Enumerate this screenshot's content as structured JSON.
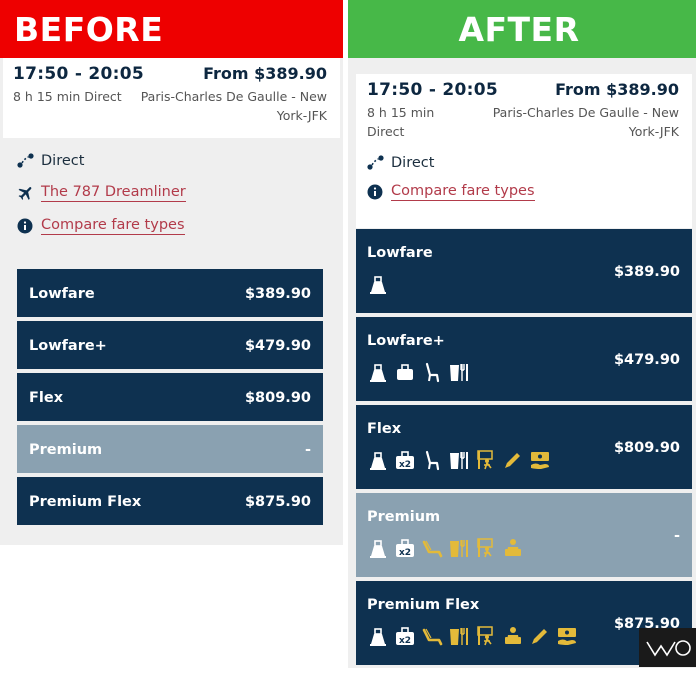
{
  "before": {
    "banner": "BEFORE",
    "flight": {
      "times": "17:50 - 20:05",
      "price": "From $389.90",
      "duration": "8 h 15 min Direct",
      "route": "Paris-Charles De Gaulle - New York-JFK"
    },
    "info": {
      "direct": "Direct",
      "aircraft": "The 787 Dreamliner",
      "compare": "Compare fare types"
    },
    "fares": [
      {
        "name": "Lowfare",
        "price": "$389.90"
      },
      {
        "name": "Lowfare+",
        "price": "$479.90"
      },
      {
        "name": "Flex",
        "price": "$809.90"
      },
      {
        "name": "Premium",
        "price": "-"
      },
      {
        "name": "Premium Flex",
        "price": "$875.90"
      }
    ]
  },
  "after": {
    "banner": "AFTER",
    "flight": {
      "times": "17:50 - 20:05",
      "price": "From $389.90",
      "duration": "8 h 15 min Direct",
      "route": "Paris-Charles De Gaulle - New York-JFK"
    },
    "info": {
      "direct": "Direct",
      "compare": "Compare fare types"
    },
    "fares": [
      {
        "name": "Lowfare",
        "price": "$389.90",
        "amenities": [
          "carry-on-bag-icon"
        ]
      },
      {
        "name": "Lowfare+",
        "price": "$479.90",
        "amenities": [
          "carry-on-bag-icon",
          "checked-bag-icon",
          "seat-icon",
          "drink-meal-icon"
        ]
      },
      {
        "name": "Flex",
        "price": "$809.90",
        "amenities": [
          "carry-on-bag-icon",
          "checked-bag-x2-icon",
          "seat-icon",
          "drink-meal-icon",
          "fast-track-icon",
          "change-pencil-icon",
          "refund-icon"
        ]
      },
      {
        "name": "Premium",
        "price": "-",
        "amenities": [
          "carry-on-bag-icon",
          "checked-bag-x2-icon",
          "premium-seat-icon",
          "drink-meal-icon",
          "fast-track-icon",
          "lounge-icon"
        ]
      },
      {
        "name": "Premium Flex",
        "price": "$875.90",
        "amenities": [
          "carry-on-bag-icon",
          "checked-bag-x2-icon",
          "premium-seat-icon",
          "drink-meal-icon",
          "fast-track-icon",
          "lounge-icon",
          "change-pencil-icon",
          "refund-icon"
        ]
      }
    ],
    "x2_label": "x2"
  },
  "colors": {
    "before_banner": "#ee0000",
    "after_banner": "#47b848",
    "fare_dark": "#0e3150",
    "fare_premium": "#8aa1b1",
    "link": "#b23b4a",
    "gold": "#e3ba3a"
  }
}
